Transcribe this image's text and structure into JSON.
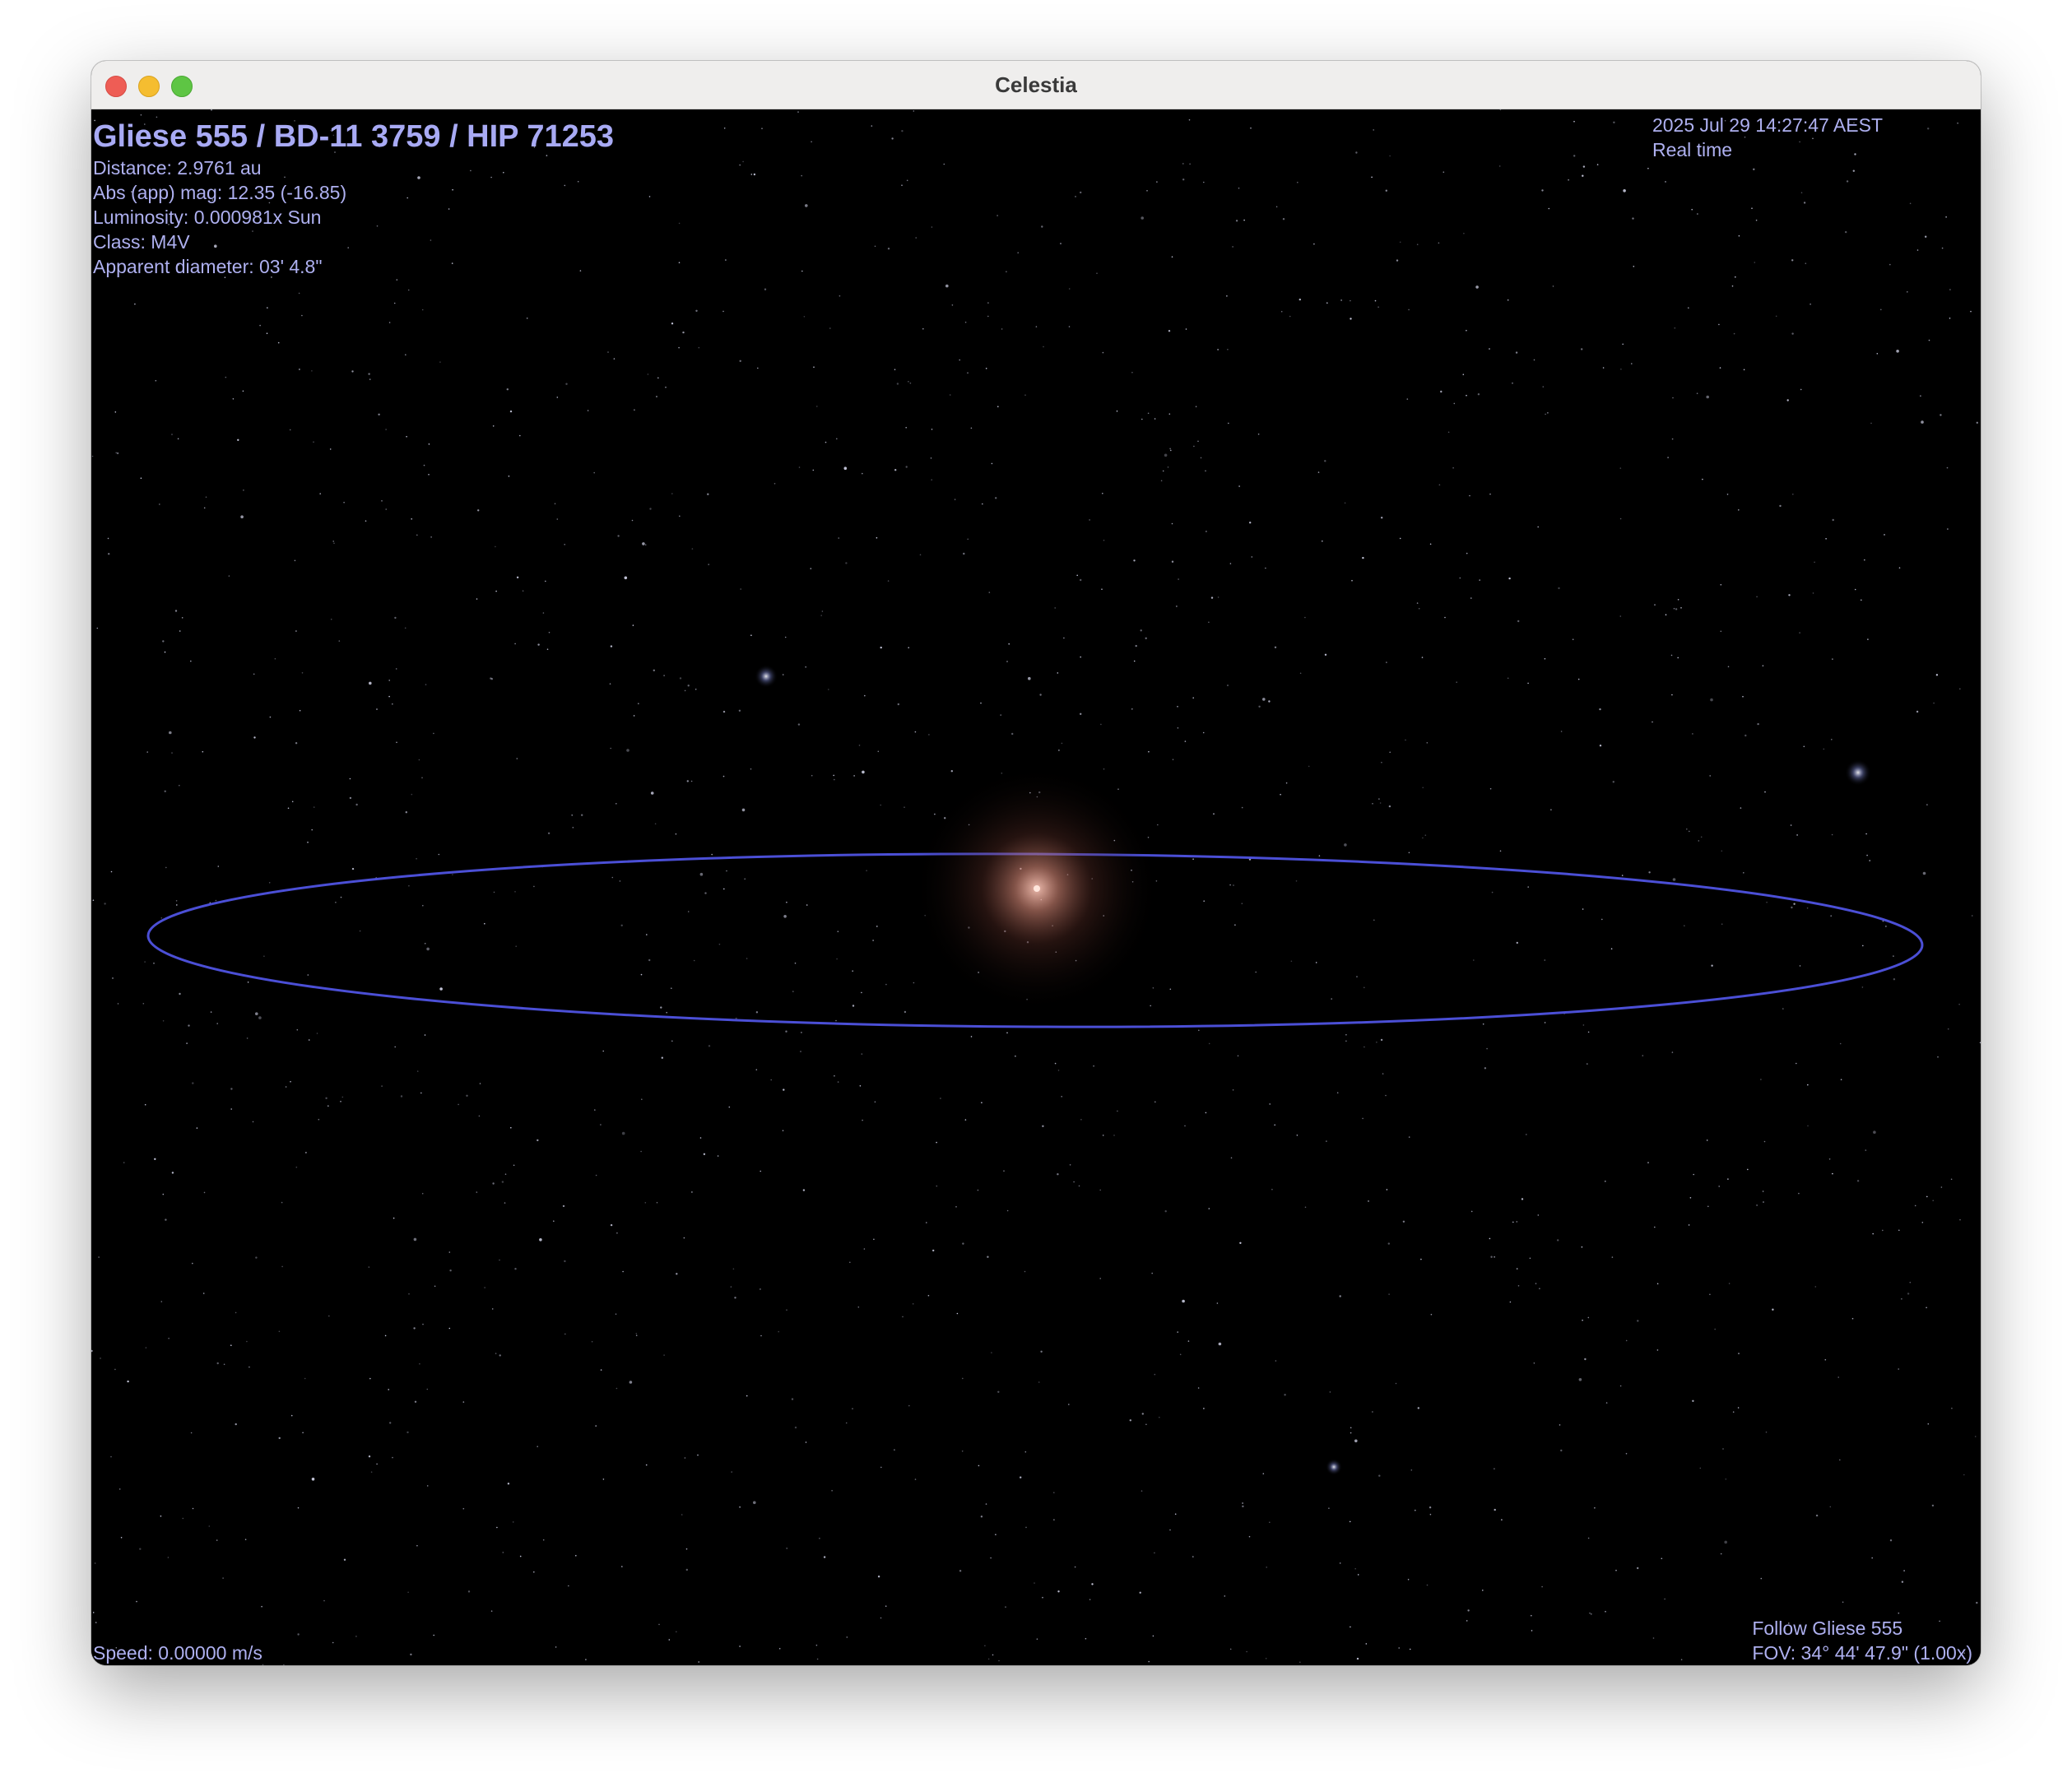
{
  "window": {
    "title": "Celestia"
  },
  "selection": {
    "name": "Gliese 555 / BD-11 3759 / HIP 71253",
    "distance": "Distance: 2.9761 au",
    "magnitude": "Abs (app) mag: 12.35 (-16.85)",
    "luminosity": "Luminosity: 0.000981x Sun",
    "class": "Class: M4V",
    "apparent_diameter": "Apparent diameter: 03' 4.8\""
  },
  "time": {
    "datetime": "2025 Jul 29 14:27:47 AEST",
    "mode": "Real time"
  },
  "status": {
    "speed": "Speed: 0.00000 m/s",
    "follow": "Follow Gliese 555",
    "fov": "FOV: 34° 44' 47.9\" (1.00x)"
  },
  "colors": {
    "hud_text": "#aeb0f0",
    "orbit": "#4b4fd6",
    "star_glow": "#e8a08c",
    "background": "#000000"
  }
}
